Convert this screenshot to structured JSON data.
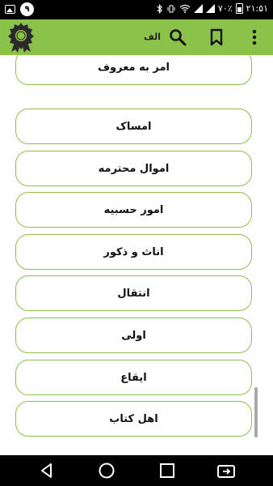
{
  "status_bar": {
    "notification_count": "۹",
    "battery_percent": "۷۰٪",
    "time": "۲۱:۵۱"
  },
  "app_bar": {
    "alef_label": "الف",
    "accent_color": "#8bc34a",
    "icons": [
      "award-badge-icon",
      "search-icon",
      "bookmark-icon",
      "more-vert-icon"
    ]
  },
  "list": {
    "items": [
      "امر به معروف",
      "امساک",
      "اموال محترمه",
      "امور حسبیه",
      "اناث و ذکور",
      "انتقال",
      "اولی",
      "ایقاع",
      "اهل کتاب"
    ]
  },
  "nav_bar": {
    "icons": [
      "back-icon",
      "home-icon",
      "recents-icon",
      "screen-cast-icon"
    ]
  }
}
